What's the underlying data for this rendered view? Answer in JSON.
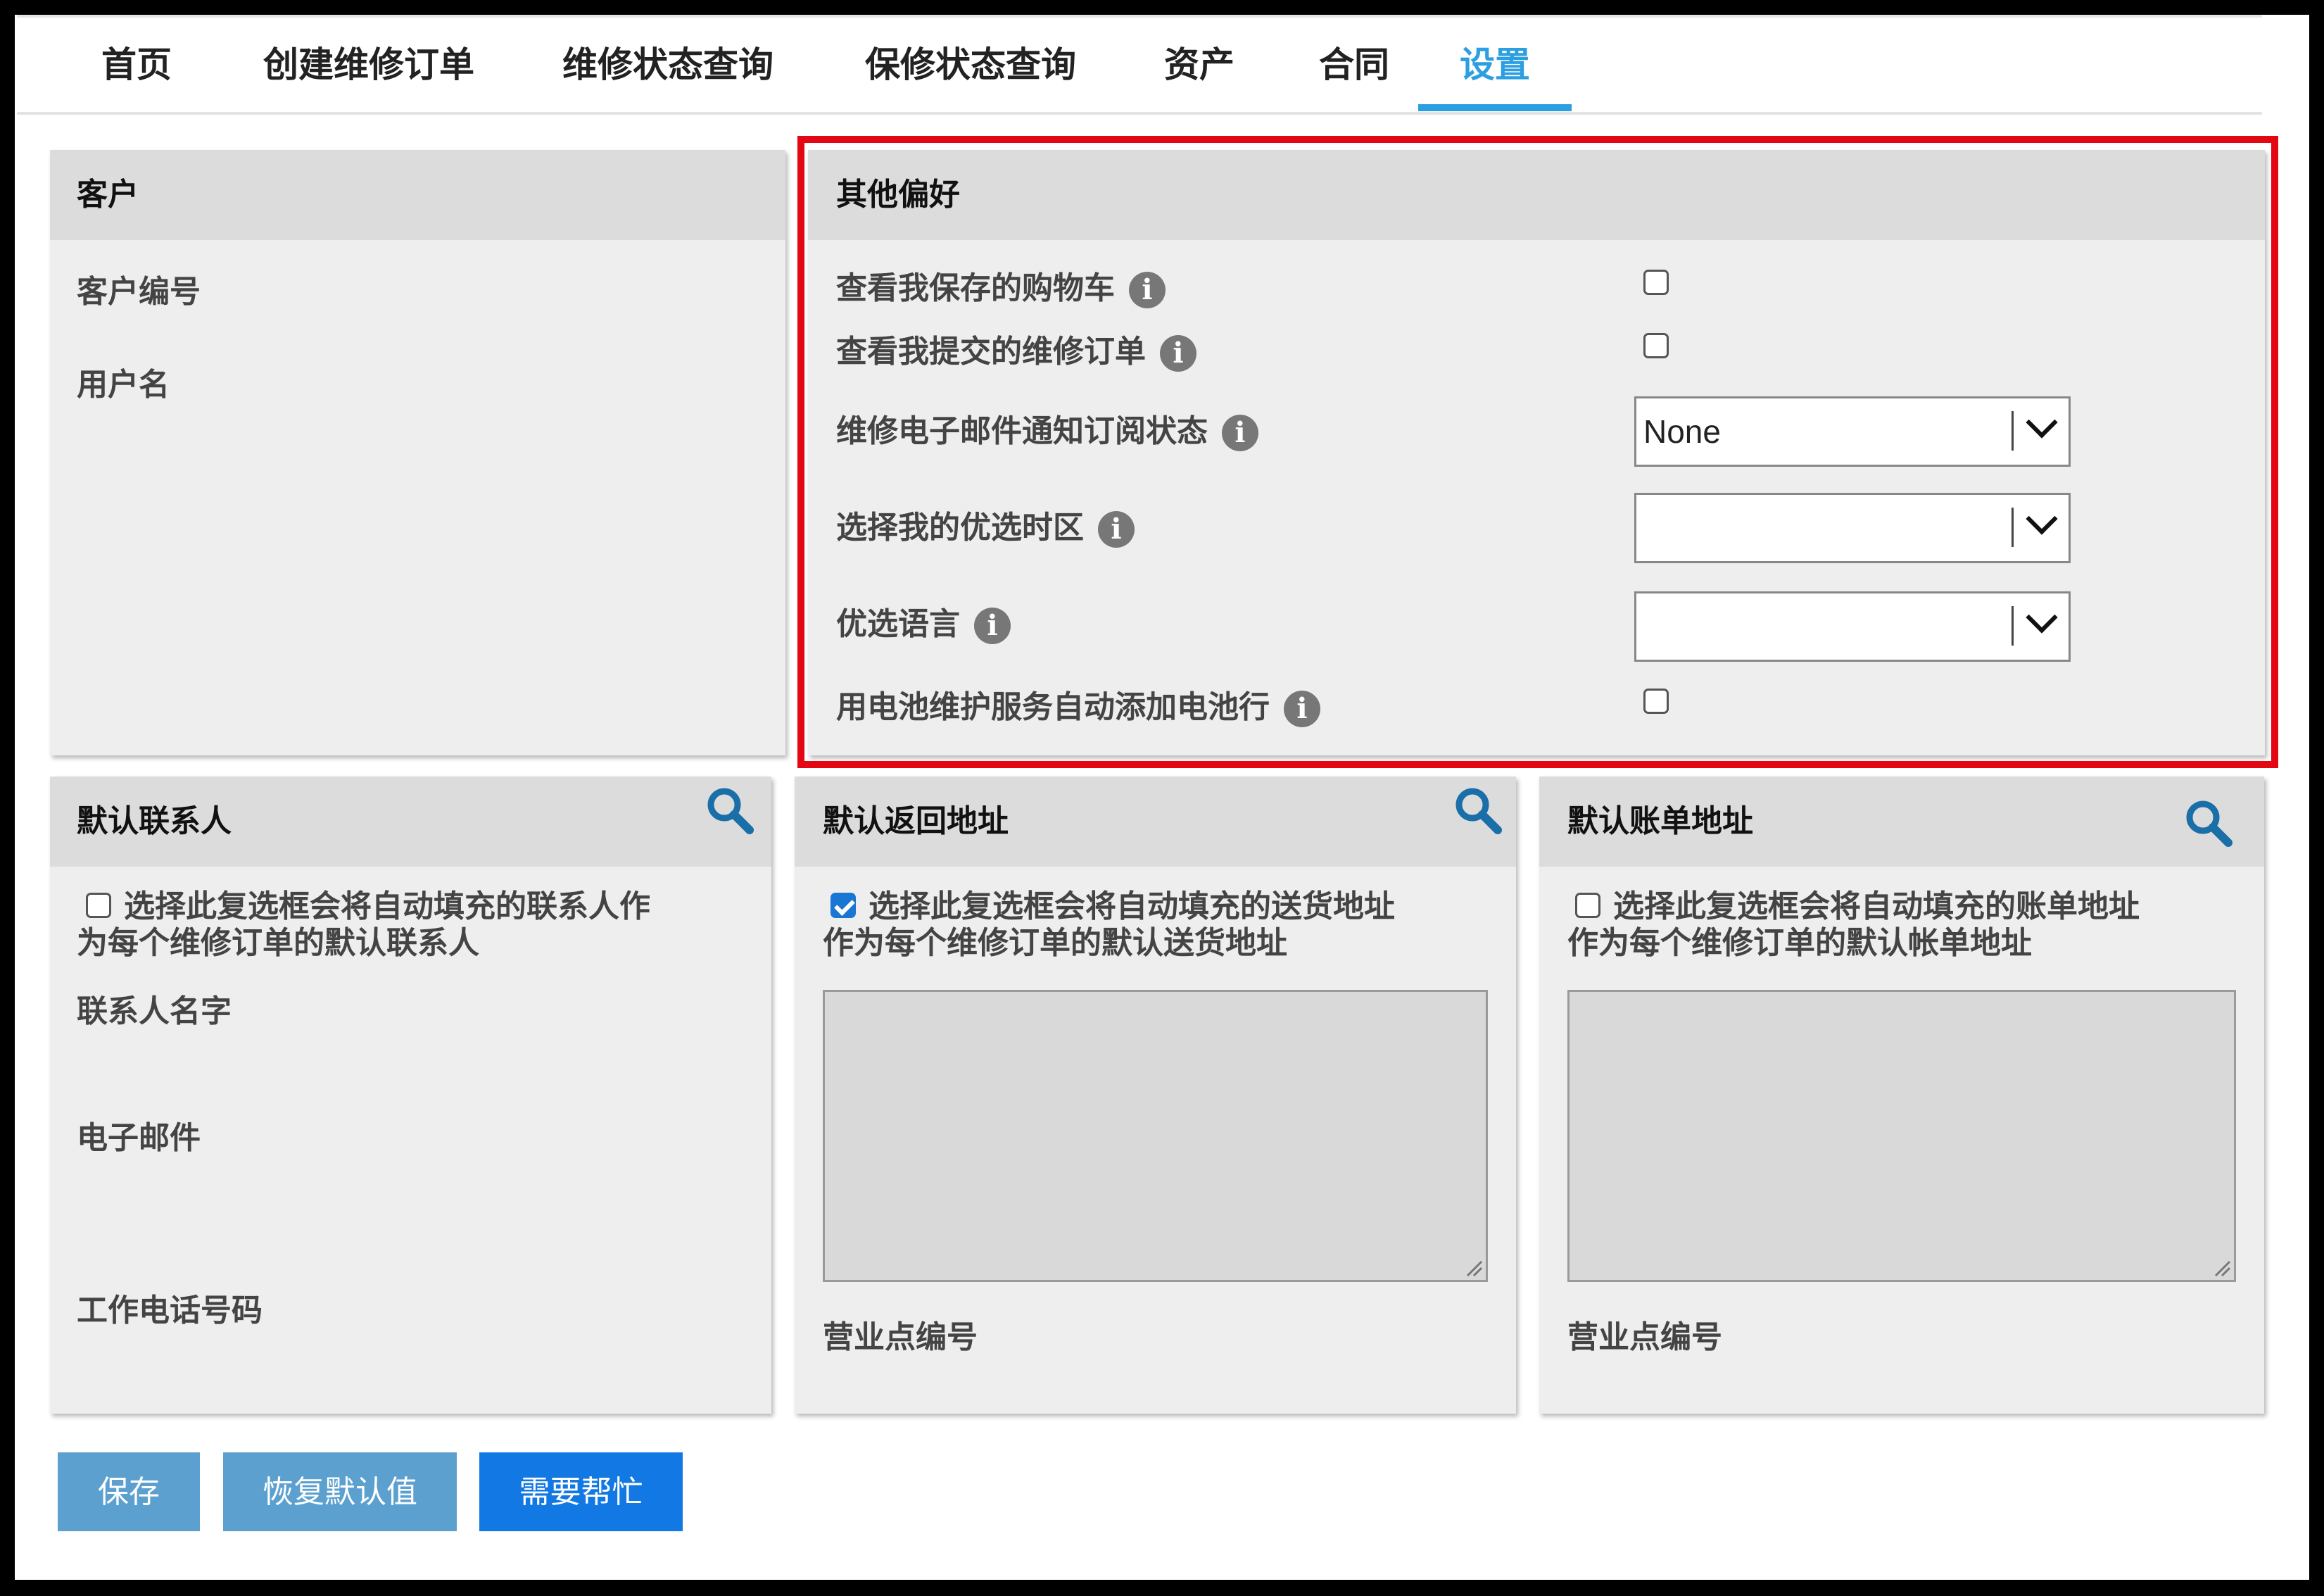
{
  "nav": {
    "tabs": [
      {
        "label": "首页"
      },
      {
        "label": "创建维修订单"
      },
      {
        "label": "维修状态查询"
      },
      {
        "label": "保修状态查询"
      },
      {
        "label": "资产"
      },
      {
        "label": "合同"
      },
      {
        "label": "设置",
        "active": true
      }
    ]
  },
  "customer": {
    "title": "客户",
    "customer_number_label": "客户编号",
    "username_label": "用户名"
  },
  "preferences": {
    "title": "其他偏好",
    "view_saved_carts": {
      "label": "查看我保存的购物车",
      "checked": false
    },
    "view_submitted_orders": {
      "label": "查看我提交的维修订单",
      "checked": false
    },
    "email_subscription": {
      "label": "维修电子邮件通知订阅状态",
      "value": "None"
    },
    "timezone": {
      "label": "选择我的优选时区",
      "value": ""
    },
    "language": {
      "label": "优选语言",
      "value": ""
    },
    "battery_auto_add": {
      "label": "用电池维护服务自动添加电池行",
      "checked": false
    },
    "info_glyph": "i"
  },
  "default_contact": {
    "title": "默认联系人",
    "checkbox_text_1": "选择此复选框会将自动填充的联系人作",
    "checkbox_text_2": "为每个维修订单的默认联系人",
    "checked": false,
    "contact_name_label": "联系人名字",
    "email_label": "电子邮件",
    "work_phone_label": "工作电话号码"
  },
  "default_return": {
    "title": "默认返回地址",
    "checkbox_text_1": "选择此复选框会将自动填充的送货地址",
    "checkbox_text_2": "作为每个维修订单的默认送货地址",
    "checked": true,
    "site_number_label": "营业点编号"
  },
  "default_billing": {
    "title": "默认账单地址",
    "checkbox_text_1": "选择此复选框会将自动填充的账单地址",
    "checkbox_text_2": "作为每个维修订单的默认帐单地址",
    "checked": false,
    "site_number_label": "营业点编号"
  },
  "buttons": {
    "save": "保存",
    "restore_defaults": "恢复默认值",
    "need_help": "需要帮忙"
  },
  "colors": {
    "accent": "#2c9fe0",
    "highlight": "#e30613",
    "search_icon": "#1a6fa8",
    "button_light": "#5ba0cf",
    "button_dark": "#1278e3"
  }
}
